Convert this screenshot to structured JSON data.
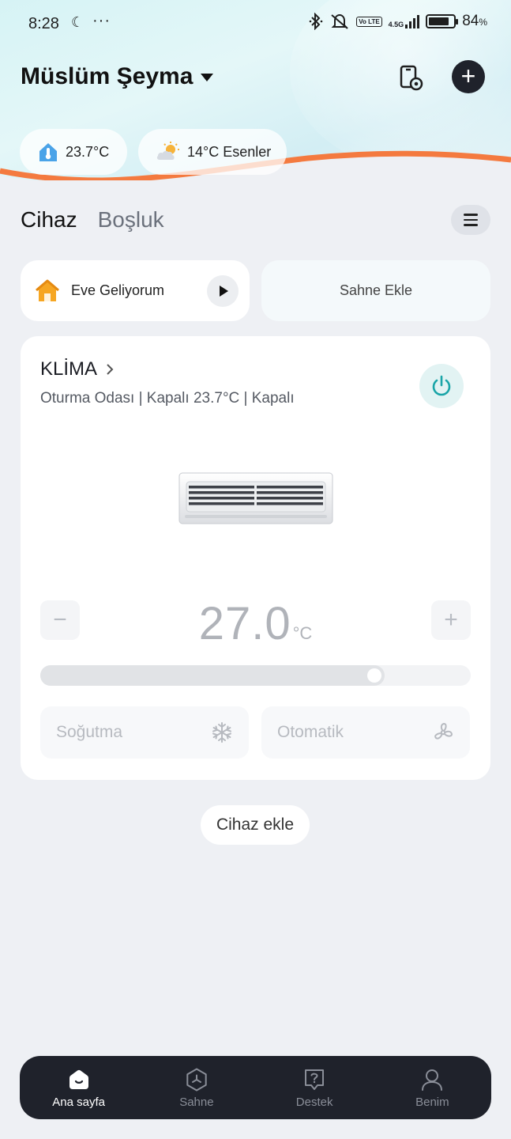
{
  "status_bar": {
    "time": "8:28",
    "battery_percent": "84",
    "battery_level": 0.84,
    "battery_unit": "%",
    "network_label": "4.5G",
    "volte_label": "Vo LTE"
  },
  "header": {
    "home_name": "Müslüm Şeyma"
  },
  "weather": {
    "indoor_temp": "23.7°C",
    "outdoor": "14°C Esenler"
  },
  "tabs": [
    {
      "label": "Cihaz",
      "active": true
    },
    {
      "label": "Boşluk",
      "active": false
    }
  ],
  "scenes": {
    "home_scene_label": "Eve Geliyorum",
    "add_scene_label": "Sahne Ekle"
  },
  "device": {
    "name": "KLİMA",
    "subtitle": "Oturma Odası | Kapalı 23.7°C | Kapalı",
    "target_temp": "27.0",
    "temp_unit": "°C",
    "minus_symbol": "−",
    "plus_symbol": "+",
    "slider_fraction": 0.8,
    "mode_label": "Soğutma",
    "fan_label": "Otomatik"
  },
  "add_device_label": "Cihaz ekle",
  "bottom_nav": [
    {
      "label": "Ana sayfa",
      "icon": "home-icon",
      "active": true
    },
    {
      "label": "Sahne",
      "icon": "scene-icon",
      "active": false
    },
    {
      "label": "Destek",
      "icon": "support-icon",
      "active": false
    },
    {
      "label": "Benim",
      "icon": "profile-icon",
      "active": false
    }
  ],
  "colors": {
    "accent_orange": "#f47a3f",
    "power_teal": "#1aa5a8",
    "nav_dark": "#1f222b"
  }
}
